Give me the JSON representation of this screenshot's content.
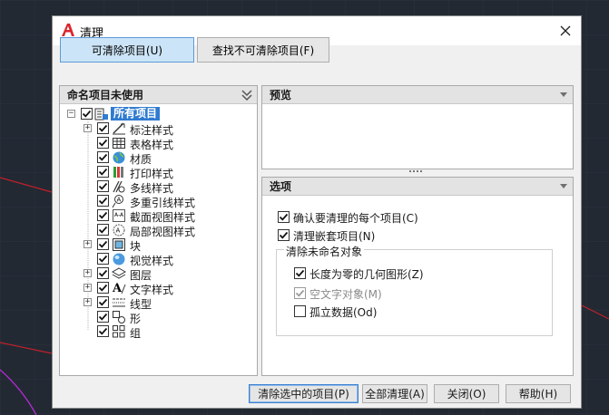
{
  "window": {
    "title": "清理"
  },
  "tabs": {
    "purgeable": "可清除项目(U)",
    "nonpurgeable": "查找不可清除项目(F)"
  },
  "left_panel": {
    "header": "命名项目未使用",
    "root": {
      "label": "所有项目",
      "checked": true
    },
    "items": [
      {
        "label": "标注样式",
        "icon": "dimension-style-icon",
        "expandable": true,
        "checked": true
      },
      {
        "label": "表格样式",
        "icon": "table-style-icon",
        "expandable": false,
        "checked": true
      },
      {
        "label": "材质",
        "icon": "material-globe-icon",
        "expandable": false,
        "checked": true
      },
      {
        "label": "打印样式",
        "icon": "plot-style-icon",
        "expandable": false,
        "checked": true
      },
      {
        "label": "多线样式",
        "icon": "multiline-style-icon",
        "expandable": false,
        "checked": true
      },
      {
        "label": "多重引线样式",
        "icon": "multileader-style-icon",
        "expandable": false,
        "checked": true
      },
      {
        "label": "截面视图样式",
        "icon": "section-view-style-icon",
        "expandable": false,
        "checked": true
      },
      {
        "label": "局部视图样式",
        "icon": "detail-view-style-icon",
        "expandable": false,
        "checked": true
      },
      {
        "label": "块",
        "icon": "block-icon",
        "expandable": true,
        "checked": true
      },
      {
        "label": "视觉样式",
        "icon": "visual-style-icon",
        "expandable": false,
        "checked": true
      },
      {
        "label": "图层",
        "icon": "layer-icon",
        "expandable": true,
        "checked": true
      },
      {
        "label": "文字样式",
        "icon": "text-style-icon",
        "expandable": true,
        "checked": true
      },
      {
        "label": "线型",
        "icon": "linetype-icon",
        "expandable": true,
        "checked": true
      },
      {
        "label": "形",
        "icon": "shape-icon",
        "expandable": false,
        "checked": true
      },
      {
        "label": "组",
        "icon": "group-icon",
        "expandable": false,
        "checked": true
      }
    ]
  },
  "preview_panel": {
    "header": "预览"
  },
  "options_panel": {
    "header": "选项",
    "confirm_each": {
      "label": "确认要清理的每个项目(C)",
      "checked": true
    },
    "purge_nested": {
      "label": "清理嵌套项目(N)",
      "checked": true
    },
    "unnamed_group": {
      "title": "清除未命名对象",
      "zero_length": {
        "label": "长度为零的几何图形(Z)",
        "checked": true
      },
      "empty_text": {
        "label": "空文字对象(M)",
        "checked": true,
        "disabled": true
      },
      "orphaned_data": {
        "label": "孤立数据(Od)",
        "checked": false
      }
    }
  },
  "buttons": {
    "purge_checked": "清除选中的项目(P)",
    "purge_all": "全部清理(A)",
    "close": "关闭(O)",
    "help": "帮助(H)"
  },
  "colors": {
    "accent": "#2f7bd1",
    "tab_active": "#cce4f7",
    "logo_red": "#d9262c",
    "background": "#222933"
  }
}
